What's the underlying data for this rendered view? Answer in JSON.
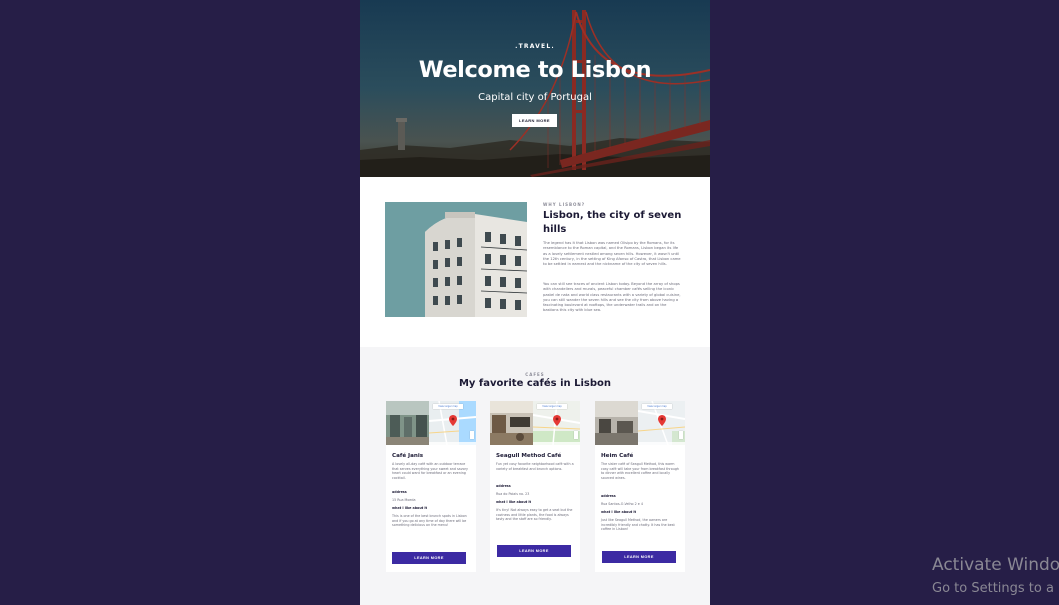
{
  "hero": {
    "kicker": ".TRAVEL.",
    "title": "Welcome to Lisbon",
    "subtitle": "Capital city of Portugal",
    "button_label": "LEARN MORE"
  },
  "about": {
    "kicker": "WHY LISBON?",
    "title": "Lisbon, the city of seven hills",
    "paragraph_1": "The legend has it that Lisbon was named Olisipo by the Romans, for its resemblance to the Roman capital, and the Romans, Lisbon began its life as a lovely settlement nestled among seven hills. However, it wasn't until the 12th century, in the setting of King Afonso of Castro, that Lisbon came to be settled in earnest and the nickname of the city of seven hills.",
    "paragraph_2": "You can still see traces of ancient Lisbon today. Beyond the array of shops with chandeliers and murals, peaceful chamber cafés selling the iconic pastel de nata and world class restaurants with a variety of global cuisine, you can still wander the seven hills and see the city from above having a fascinating boulevard at rooftops, the underwater trails and on the bastions this city with blue sea."
  },
  "cafes": {
    "kicker": "CAFES",
    "title": "My favorite cafés in Lisbon",
    "map_link": "View larger map",
    "cards": [
      {
        "name": "Café Janis",
        "description": "A lovely all-day café with an outdoor terrace that serves everything your sweet and savory heart could want for breakfast or an evening cocktail.",
        "address_label": "address",
        "address": "15 Rua Moeda",
        "about_label": "what I like about it",
        "about": "This is one of the best brunch spots in Lisbon and if you go at any time of day there will be something delicious on the menu!",
        "button_label": "LEARN MORE"
      },
      {
        "name": "Seagull Method Café",
        "description": "Fun yet cosy favorite neighborhood café with a variety of breakfast and brunch options.",
        "address_label": "address",
        "address": "Rua do Poiais no. 23",
        "about_label": "what I like about it",
        "about": "It's tiny! Not always easy to get a seat but the coziness and little plants, the food is always tasty and the staff are so friendly.",
        "button_label": "LEARN MORE"
      },
      {
        "name": "Heim Café",
        "description": "The sister café of Seagull Method, this warm cosy café will take your from breakfast through to dinner with excellent coffee and locally sourced wines.",
        "address_label": "address",
        "address": "Rua Santos-O-Velho 2 e 4",
        "about_label": "what I like about it",
        "about": "Just like Seagull Method, the owners are incredibly friendly and chatty. It has the best coffee in Lisbon!",
        "button_label": "LEARN MORE"
      }
    ]
  },
  "watermark": {
    "title": "Activate Windo",
    "subtitle": "Go to Settings to a"
  },
  "colors": {
    "backdrop": "#261e47",
    "accent": "#3c2aa3",
    "heading": "#1c1a35"
  }
}
